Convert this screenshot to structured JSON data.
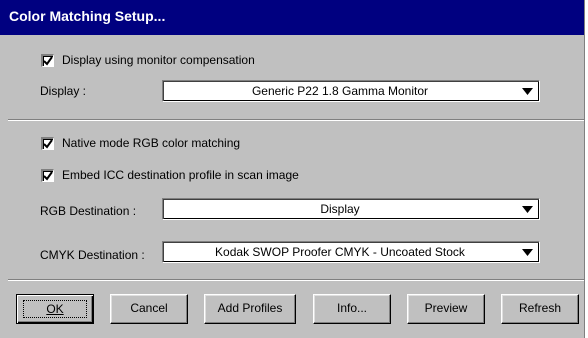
{
  "window": {
    "title": "Color Matching Setup..."
  },
  "monitor": {
    "checkbox_label": "Display using monitor compensation",
    "checked": true,
    "display_label": "Display :",
    "display_value": "Generic P22 1.8 Gamma Monitor"
  },
  "rgb_matching": {
    "native_label": "Native mode RGB color matching",
    "native_checked": true,
    "embed_label": "Embed ICC destination profile in scan image",
    "embed_checked": true,
    "rgb_dest_label": "RGB Destination :",
    "rgb_dest_value": "Display",
    "cmyk_dest_label": "CMYK Destination :",
    "cmyk_dest_value": "Kodak SWOP Proofer CMYK - Uncoated Stock"
  },
  "buttons": {
    "ok": "OK",
    "cancel": "Cancel",
    "add_profiles": "Add Profiles",
    "info": "Info...",
    "preview": "Preview",
    "refresh": "Refresh"
  },
  "colors": {
    "title_bar": "#000080",
    "dialog_face": "#c0c0c0"
  }
}
